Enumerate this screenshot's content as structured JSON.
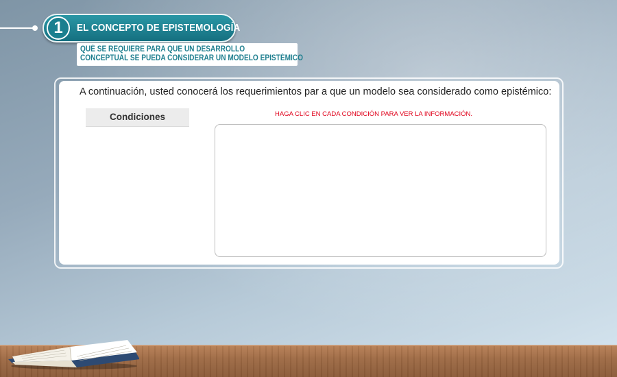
{
  "header": {
    "number": "1",
    "title": "EL CONCEPTO DE EPISTEMOLOGÍA",
    "subtitle_line1": "QUÉ SE REQUIERE PARA QUE UN DESARROLLO",
    "subtitle_line2": "CONCEPTUAL SE PUEDA CONSIDERAR UN MODELO EPISTÉMICO"
  },
  "content": {
    "intro": "A continuación, usted conocerá los requerimientos par a que un modelo sea considerado como epistémico:",
    "conditions_header": "Condiciones",
    "hint": "HAGA  CLIC EN CADA CONDICIÓN PARA VER LA INFORMACIÓN."
  },
  "colors": {
    "accent_teal": "#1b7f8f",
    "hint_red": "#e0001a"
  },
  "icons": {
    "decoration": "open-book-icon"
  }
}
